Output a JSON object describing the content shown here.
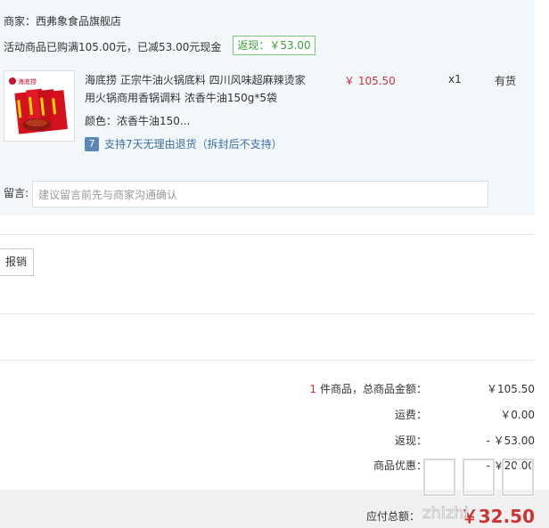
{
  "store": {
    "merchant_label": "商家：西弗象食品旗舰店",
    "promo_text": "活动商品已购满105.00元，已减53.00元现金",
    "rebate_badge": "返现：￥53.00"
  },
  "product": {
    "thumb_brand": "海底捞",
    "title": "海底捞 正宗牛油火锅底料 四川风味超麻辣烫家用火锅商用香锅调料 浓香牛油150g*5袋",
    "price": "￥ 105.50",
    "qty": "x1",
    "stock": "有货",
    "color": "颜色：浓香牛油150...",
    "return_icon": "7",
    "return_policy": "支持7天无理由退货（拆封后不支持）"
  },
  "message": {
    "label": "留言:",
    "placeholder": "建议留言前先与商家沟通确认"
  },
  "reimburse_button": "报销",
  "summary": {
    "count": "1",
    "count_suffix": " 件商品，总商品金额：",
    "total": "￥105.50",
    "shipping_label": "运费：",
    "shipping": "￥0.00",
    "rebate_label": "返现：",
    "rebate": "- ￥53.00",
    "discount_label": "商品优惠：",
    "discount": "- ￥20.00"
  },
  "footer": {
    "pay_label": "应付总额：",
    "pay_value": "￥32.50"
  },
  "watermark": "zhizhi"
}
